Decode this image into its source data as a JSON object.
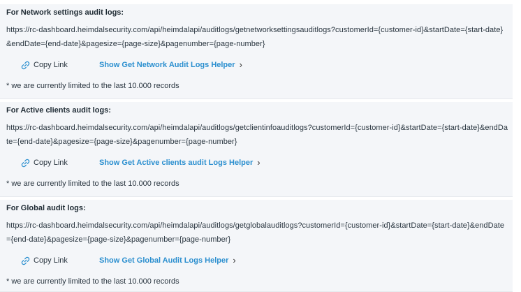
{
  "sections": [
    {
      "heading": "For Network settings audit logs:",
      "url": "https://rc-dashboard.heimdalsecurity.com/api/heimdalapi/auditlogs/getnetworksettingsauditlogs?customerId={customer-id}&startDate={start-date}&endDate={end-date}&pagesize={page-size}&pagenumber={page-number}",
      "copy_label": "Copy Link",
      "helper_label": "Show Get Network Audit Logs Helper",
      "note": "* we are currently limited to the last 10.000 records"
    },
    {
      "heading": "For Active clients audit logs:",
      "url": "https://rc-dashboard.heimdalsecurity.com/api/heimdalapi/auditlogs/getclientinfoauditlogs?customerId={customer-id}&startDate={start-date}&endDate={end-date}&pagesize={page-size}&pagenumber={page-number}",
      "copy_label": "Copy Link",
      "helper_label": "Show Get Active clients audit Logs Helper",
      "note": "* we are currently limited to the last 10.000 records"
    },
    {
      "heading": "For Global audit logs:",
      "url": "https://rc-dashboard.heimdalsecurity.com/api/heimdalapi/auditlogs/getglobalauditlogs?customerId={customer-id}&startDate={start-date}&endDate={end-date}&pagesize={page-size}&pagenumber={page-number}",
      "copy_label": "Copy Link",
      "helper_label": "Show Get Global Audit Logs Helper",
      "note": "* we are currently limited to the last 10.000 records"
    }
  ],
  "icons": {
    "copy": "link-icon",
    "expand": "chevron-right-icon"
  },
  "colors": {
    "helper_link": "#2b8fcf",
    "panel_bg": "#f4f6f9"
  }
}
